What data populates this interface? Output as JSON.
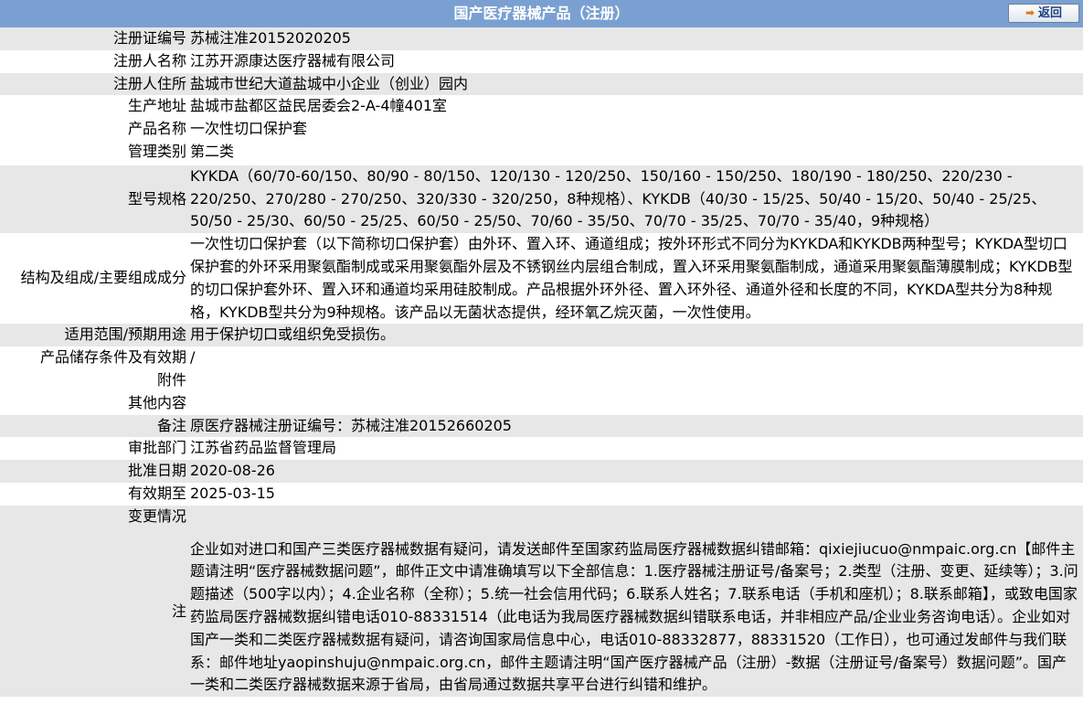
{
  "header": {
    "title": "国产医疗器械产品（注册）",
    "back_label": "返回"
  },
  "fields": [
    {
      "label": "注册证编号",
      "value": "苏械注准20152020205"
    },
    {
      "label": "注册人名称",
      "value": "江苏开源康达医疗器械有限公司"
    },
    {
      "label": "注册人住所",
      "value": "盐城市世纪大道盐城中小企业（创业）园内"
    },
    {
      "label": "生产地址",
      "value": "盐城市盐都区益民居委会2-A-4幢401室"
    },
    {
      "label": "产品名称",
      "value": "一次性切口保护套"
    },
    {
      "label": "管理类别",
      "value": "第二类"
    },
    {
      "label": "型号规格",
      "value": "KYKDA（60/70-60/150、80/90 - 80/150、120/130 - 120/250、150/160 - 150/250、180/190 - 180/250、220/230 - 220/250、270/280 - 270/250、320/330 - 320/250，8种规格）、KYKDB（40/30 - 15/25、50/40 - 15/20、50/40 - 25/25、50/50 - 25/30、60/50 - 25/25、60/50 - 25/50、70/60 - 35/50、70/70 - 35/25、70/70 - 35/40，9种规格）"
    },
    {
      "label": "结构及组成/主要组成成分",
      "value": "一次性切口保护套（以下简称切口保护套）由外环、置入环、通道组成；按外环形式不同分为KYKDA和KYKDB两种型号；KYKDA型切口保护套的外环采用聚氨酯制成或采用聚氨酯外层及不锈钢丝内层组合制成，置入环采用聚氨酯制成，通道采用聚氨酯薄膜制成；KYKDB型的切口保护套外环、置入环和通道均采用硅胶制成。产品根据外环外径、置入环外径、通道外径和长度的不同，KYKDA型共分为8种规格，KYKDB型共分为9种规格。该产品以无菌状态提供，经环氧乙烷灭菌，一次性使用。"
    },
    {
      "label": "适用范围/预期用途",
      "value": "用于保护切口或组织免受损伤。"
    },
    {
      "label": "产品储存条件及有效期",
      "value": "/"
    },
    {
      "label": "附件",
      "value": ""
    },
    {
      "label": "其他内容",
      "value": ""
    },
    {
      "label": "备注",
      "value": "原医疗器械注册证编号：苏械注准20152660205"
    },
    {
      "label": "审批部门",
      "value": "江苏省药品监督管理局"
    },
    {
      "label": "批准日期",
      "value": "2020-08-26"
    },
    {
      "label": "有效期至",
      "value": "2025-03-15"
    },
    {
      "label": "变更情况",
      "value": ""
    }
  ],
  "note": {
    "label": "注",
    "text": "企业如对进口和国产三类医疗器械数据有疑问，请发送邮件至国家药监局医疗器械数据纠错邮箱：qixiejiucuo@nmpaic.org.cn【邮件主题请注明“医疗器械数据问题”，邮件正文中请准确填写以下全部信息：1.医疗器械注册证号/备案号；2.类型（注册、变更、延续等）；3.问题描述（500字以内）；4.企业名称（全称）；5.统一社会信用代码；6.联系人姓名；7.联系电话（手机和座机）；8.联系邮箱】，或致电国家药监局医疗器械数据纠错电话010-88331514（此电话为我局医疗器械数据纠错联系电话，并非相应产品/企业业务咨询电话）。企业如对国产一类和二类医疗器械数据有疑问，请咨询国家局信息中心，电话010-88332877，88331520（工作日），也可通过发邮件与我们联系：邮件地址yaopinshuju@nmpaic.org.cn，邮件主题请注明“国产医疗器械产品（注册）-数据（注册证号/备案号）数据问题”。国产一类和二类医疗器械数据来源于省局，由省局通过数据共享平台进行纠错和维护。"
  }
}
